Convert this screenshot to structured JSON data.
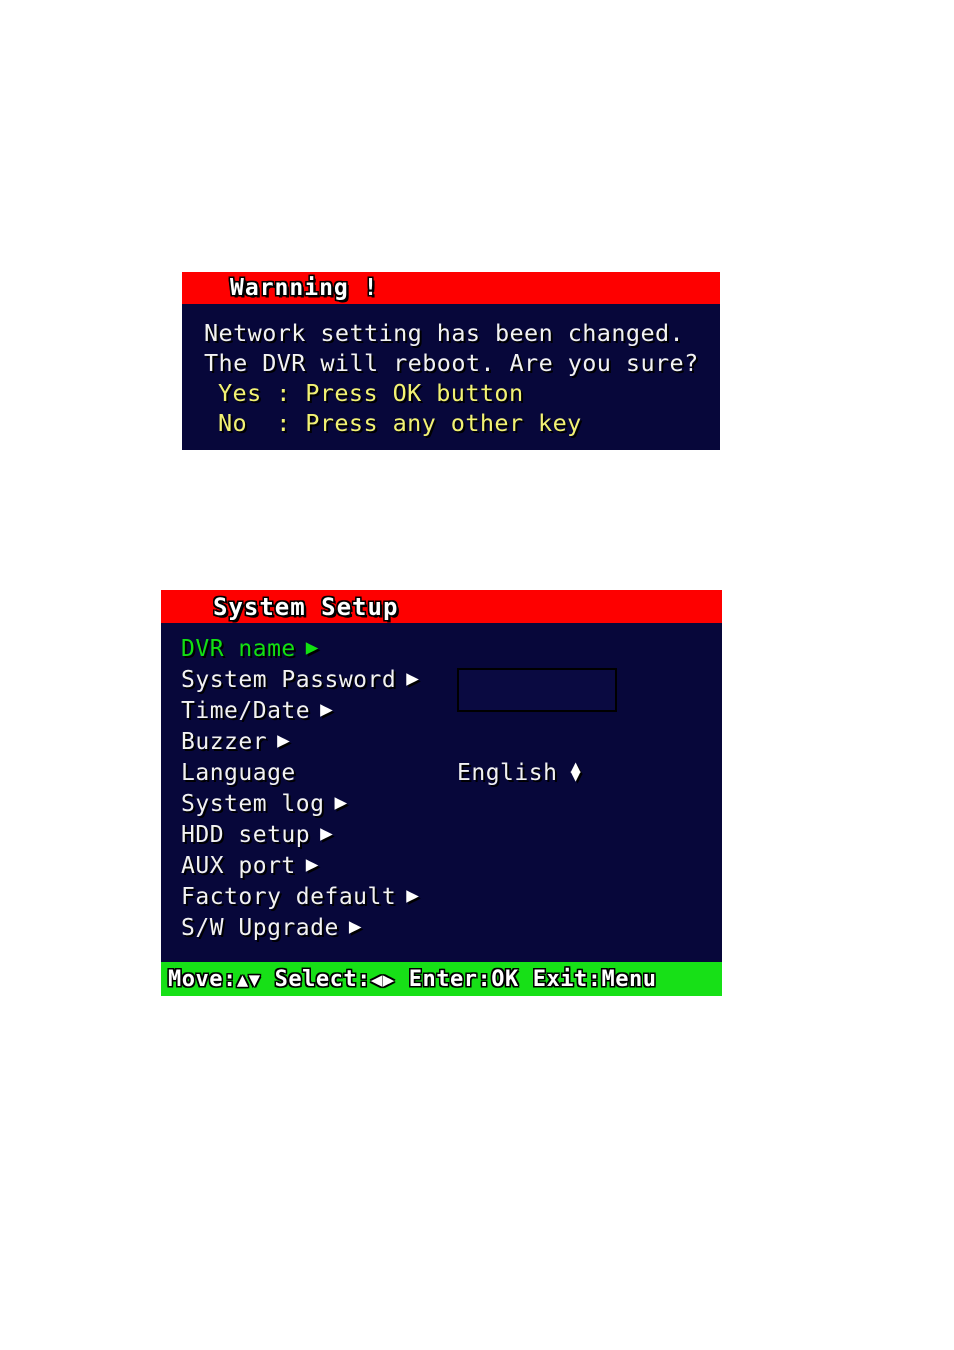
{
  "warning_dialog": {
    "title": "Warnning !",
    "lines": [
      {
        "text": "Network setting has been changed.",
        "style": "white"
      },
      {
        "text": "The DVR will reboot. Are you sure?",
        "style": "white"
      },
      {
        "text": "Yes : Press OK button",
        "style": "yellow"
      },
      {
        "text": "No  : Press any other key",
        "style": "yellow"
      }
    ],
    "colors": {
      "titlebar": "#fe0000",
      "background": "#07073a",
      "body_text": "#f2f2f2",
      "prompt_text": "#f2f274"
    }
  },
  "system_setup": {
    "title": "System Setup",
    "selected_index": 0,
    "items": [
      {
        "label": "DVR name",
        "arrow": "▶",
        "value": "",
        "has_field": true
      },
      {
        "label": "System Password",
        "arrow": "▶",
        "value": "",
        "has_field": false
      },
      {
        "label": "Time/Date",
        "arrow": "▶",
        "value": "",
        "has_field": false
      },
      {
        "label": "Buzzer",
        "arrow": "▶",
        "value": "",
        "has_field": false
      },
      {
        "label": "Language",
        "arrow": "",
        "value": "English",
        "has_field": false
      },
      {
        "label": "System log",
        "arrow": "▶",
        "value": "",
        "has_field": false
      },
      {
        "label": "HDD setup",
        "arrow": "▶",
        "value": "",
        "has_field": false
      },
      {
        "label": "AUX port",
        "arrow": "▶",
        "value": "",
        "has_field": false
      },
      {
        "label": "Factory default",
        "arrow": "▶",
        "value": "",
        "has_field": false
      },
      {
        "label": "S/W Upgrade",
        "arrow": "▶",
        "value": "",
        "has_field": false
      }
    ],
    "dvr_name_field_value": "",
    "footer": [
      {
        "label": "Move:",
        "glyphs": "▲▼"
      },
      {
        "label": "Select:",
        "glyphs": "◀▶"
      },
      {
        "label": "Enter:",
        "glyphs": "OK"
      },
      {
        "label": "Exit:",
        "glyphs": "Menu"
      }
    ],
    "colors": {
      "titlebar": "#fe0000",
      "background": "#07073a",
      "footer_bar": "#17e017",
      "selected_text": "#12e012",
      "item_text": "#f2f2f2"
    }
  }
}
